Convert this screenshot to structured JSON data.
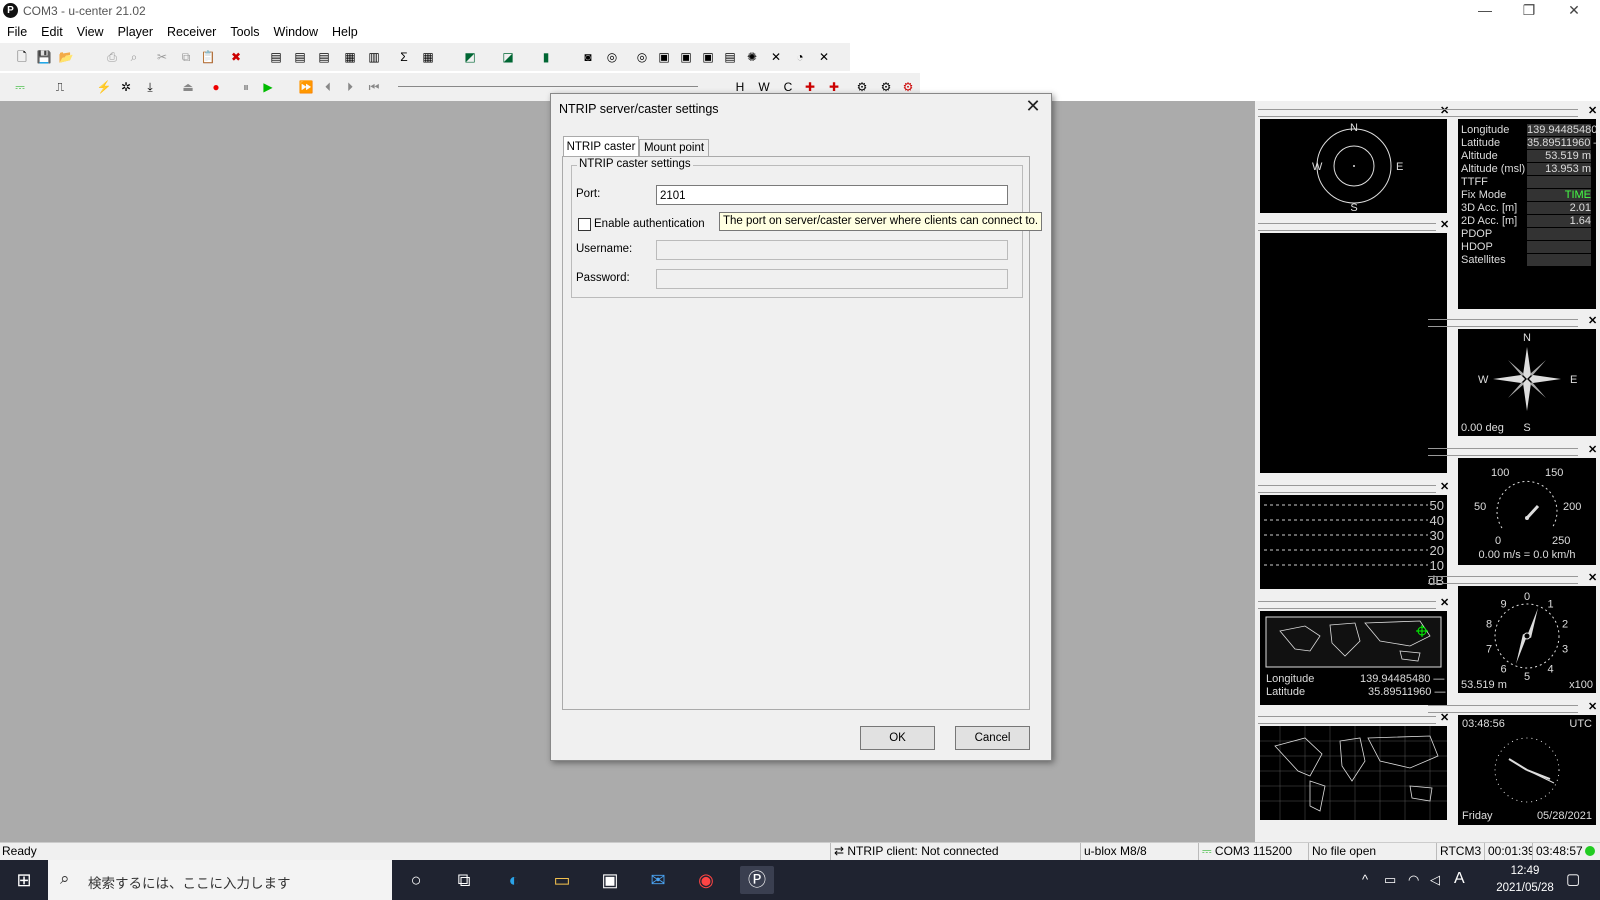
{
  "window": {
    "title": "COM3 - u-center 21.02",
    "logo": "P",
    "minimize": "—",
    "restore": "❐",
    "close": "✕"
  },
  "menu": [
    "File",
    "Edit",
    "View",
    "Player",
    "Receiver",
    "Tools",
    "Window",
    "Help"
  ],
  "dialog": {
    "title": "NTRIP server/caster settings",
    "close": "✕",
    "tabs": [
      "NTRIP caster",
      "Mount point"
    ],
    "group_label": "NTRIP caster settings",
    "port_label": "Port:",
    "port_value": "2101",
    "auth_label": "Enable authentication",
    "auth_checked": false,
    "username_label": "Username:",
    "password_label": "Password:",
    "tooltip": "The port on server/caster server where clients can connect to.",
    "ok": "OK",
    "cancel": "Cancel"
  },
  "views": {
    "sky": {
      "n": "N",
      "s": "S",
      "e": "E",
      "w": "W"
    },
    "nav": {
      "rows": [
        {
          "label": "Longitude",
          "value": "139.94485480 —"
        },
        {
          "label": "Latitude",
          "value": "35.89511960 —"
        },
        {
          "label": "Altitude",
          "value": "53.519 m"
        },
        {
          "label": "Altitude (msl)",
          "value": "13.953 m"
        },
        {
          "label": "TTFF",
          "value": ""
        },
        {
          "label": "Fix Mode",
          "value": "TIME"
        },
        {
          "label": "3D Acc. [m]",
          "value": "2.01"
        },
        {
          "label": "2D Acc. [m]",
          "value": "1.64"
        },
        {
          "label": "PDOP",
          "value": ""
        },
        {
          "label": "HDOP",
          "value": ""
        },
        {
          "label": "Satellites",
          "value": ""
        }
      ],
      "acc_min": "0",
      "acc_max": "5"
    },
    "compass": {
      "n": "N",
      "s": "S",
      "e": "E",
      "w": "W",
      "heading": "0.00 deg"
    },
    "speed": {
      "t100": "100",
      "t150": "150",
      "t50": "50",
      "t200": "200",
      "t0": "0",
      "t250": "250",
      "readout": "0.00 m/s = 0.0 km/h"
    },
    "signal": {
      "ticks": [
        "50",
        "40",
        "30",
        "20",
        "10",
        "dB"
      ]
    },
    "map_small": {
      "lon_label": "Longitude",
      "lon": "139.94485480 —",
      "lat_label": "Latitude",
      "lat": "35.89511960 —"
    },
    "altimeter": {
      "readout": "53.519 m",
      "unit": "x100",
      "dial": [
        "0",
        "1",
        "2",
        "3",
        "4",
        "5",
        "6",
        "7",
        "8",
        "9"
      ]
    },
    "clock": {
      "time": "03:48:56",
      "zone": "UTC",
      "day": "Friday",
      "date": "05/28/2021"
    }
  },
  "status": {
    "ready": "Ready",
    "ntrip": "NTRIP client: Not connected",
    "receiver": "u-blox M8/8",
    "port": "COM3 115200",
    "file": "No file open",
    "protocol": "RTCM3",
    "elapsed": "00:01:39",
    "utc": "03:48:57"
  },
  "taskbar": {
    "search_placeholder": "検索するには、ここに入力します",
    "time": "12:49",
    "date": "2021/05/28",
    "ime": "A"
  }
}
